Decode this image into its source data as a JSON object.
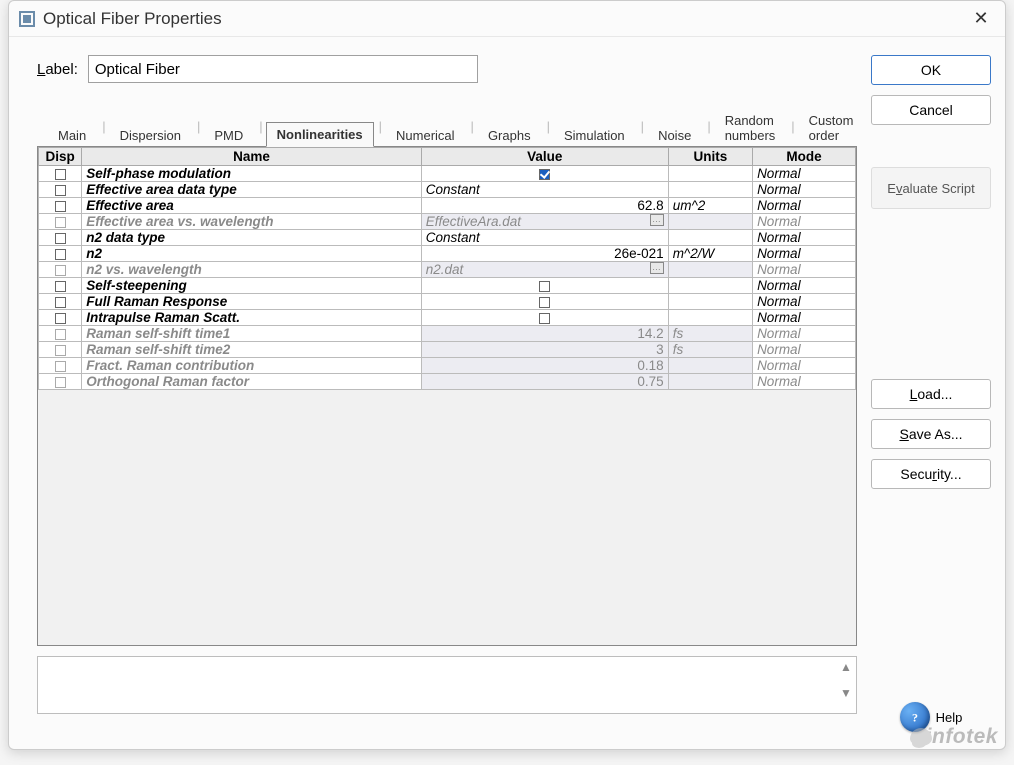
{
  "window": {
    "title": "Optical Fiber Properties"
  },
  "label_field": {
    "caption": "Label:",
    "value": "Optical Fiber"
  },
  "tabs": [
    {
      "label": "Main",
      "active": false
    },
    {
      "label": "Dispersion",
      "active": false
    },
    {
      "label": "PMD",
      "active": false
    },
    {
      "label": "Nonlinearities",
      "active": true
    },
    {
      "label": "Numerical",
      "active": false
    },
    {
      "label": "Graphs",
      "active": false
    },
    {
      "label": "Simulation",
      "active": false
    },
    {
      "label": "Noise",
      "active": false
    },
    {
      "label": "Random numbers",
      "active": false
    },
    {
      "label": "Custom order",
      "active": false
    }
  ],
  "grid": {
    "headers": {
      "disp": "Disp",
      "name": "Name",
      "value": "Value",
      "units": "Units",
      "mode": "Mode"
    },
    "rows": [
      {
        "name": "Self-phase modulation",
        "value": "",
        "value_type": "check",
        "checked": true,
        "units": "",
        "mode": "Normal",
        "disabled": false
      },
      {
        "name": "Effective area data type",
        "value": "Constant",
        "value_type": "text-left",
        "units": "",
        "mode": "Normal",
        "disabled": false
      },
      {
        "name": "Effective area",
        "value": "62.8",
        "value_type": "num",
        "units": "um^2",
        "mode": "Normal",
        "disabled": false
      },
      {
        "name": "Effective area vs. wavelength",
        "value": "EffectiveAra.dat",
        "value_type": "file",
        "units": "",
        "mode": "Normal",
        "disabled": true
      },
      {
        "name": "n2 data type",
        "value": "Constant",
        "value_type": "text-left",
        "units": "",
        "mode": "Normal",
        "disabled": false
      },
      {
        "name": "n2",
        "value": "26e-021",
        "value_type": "num",
        "units": "m^2/W",
        "mode": "Normal",
        "disabled": false
      },
      {
        "name": "n2 vs. wavelength",
        "value": "n2.dat",
        "value_type": "file",
        "units": "",
        "mode": "Normal",
        "disabled": true
      },
      {
        "name": "Self-steepening",
        "value": "",
        "value_type": "check",
        "checked": false,
        "units": "",
        "mode": "Normal",
        "disabled": false
      },
      {
        "name": "Full Raman Response",
        "value": "",
        "value_type": "check",
        "checked": false,
        "units": "",
        "mode": "Normal",
        "disabled": false
      },
      {
        "name": "Intrapulse Raman Scatt.",
        "value": "",
        "value_type": "check",
        "checked": false,
        "units": "",
        "mode": "Normal",
        "disabled": false
      },
      {
        "name": "Raman self-shift time1",
        "value": "14.2",
        "value_type": "num",
        "units": "fs",
        "mode": "Normal",
        "disabled": true
      },
      {
        "name": "Raman self-shift time2",
        "value": "3",
        "value_type": "num",
        "units": "fs",
        "mode": "Normal",
        "disabled": true
      },
      {
        "name": "Fract. Raman contribution",
        "value": "0.18",
        "value_type": "num",
        "units": "",
        "mode": "Normal",
        "disabled": true
      },
      {
        "name": "Orthogonal Raman factor",
        "value": "0.75",
        "value_type": "num",
        "units": "",
        "mode": "Normal",
        "disabled": true
      }
    ]
  },
  "buttons": {
    "ok": "OK",
    "cancel": "Cancel",
    "evaluate": "Evaluate Script",
    "load": "Load...",
    "saveas": "Save As...",
    "security": "Security...",
    "help": "Help"
  },
  "watermark": "infotek"
}
